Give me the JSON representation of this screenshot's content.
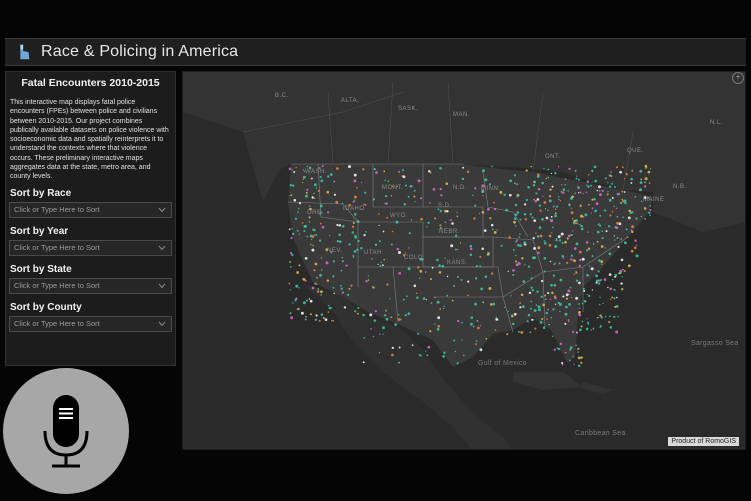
{
  "app": {
    "title": "Race & Policing in America",
    "logo_icon": "hand-pointer-icon"
  },
  "sidebar": {
    "title": "Fatal Encounters 2010-2015",
    "description": "This interactive map displays fatal police encounters (FPEs) between police and civilians between 2010-2015. Our project combines publically available datasets on police violence with socioeconomic data and spatially reinterprets it to understand the contexts where that violence occurs. These preliminary interactive maps aggregates data at the state, metro area, and county levels.",
    "filters": [
      {
        "label": "Sort by Race",
        "placeholder": "Click or Type Here to Sort"
      },
      {
        "label": "Sort by Year",
        "placeholder": "Click or Type Here to Sort"
      },
      {
        "label": "Sort by State",
        "placeholder": "Click or Type Here to Sort"
      },
      {
        "label": "Sort by County",
        "placeholder": "Click or Type Here to Sort"
      }
    ]
  },
  "voice": {
    "icon": "microphone-icon",
    "menu_icon": "menu-icon"
  },
  "map": {
    "attribution": "Product of RomoGIS",
    "labels": {
      "bc": "B.C.",
      "alta": "ALTA.",
      "sask": "SASK.",
      "man": "MAN.",
      "ont": "ONT.",
      "que": "QUE.",
      "nb": "N.B.",
      "nl": "N.L.",
      "wash": "WASH.",
      "ore": "ORE.",
      "idaho": "IDAHO",
      "mont": "MONT.",
      "nd": "N.D.",
      "sd": "S.D.",
      "minn": "MINN.",
      "wyo": "WYO.",
      "nebr": "NEBR.",
      "nev": "NEV.",
      "utah": "UTAH",
      "colo": "COLO.",
      "kans": "KANS.",
      "maine": "MAINE",
      "gulf": "Gulf of Mexico",
      "sargasso": "Sargasso Sea",
      "caribbean": "Caribbean Sea"
    },
    "colors": {
      "teal": "#3fc8a8",
      "pink": "#e06ad0",
      "yellow": "#e8c14a",
      "orange": "#e88a3a",
      "white": "#ffffff"
    }
  }
}
